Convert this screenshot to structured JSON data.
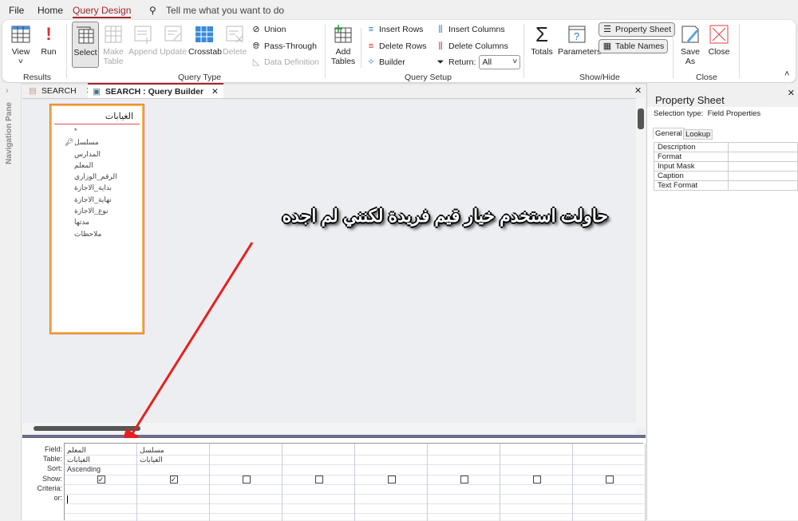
{
  "menu": {
    "items": [
      "File",
      "Home",
      "Query Design"
    ],
    "active": "Query Design",
    "tell_me": "Tell me what you want to do"
  },
  "ribbon": {
    "results": {
      "label": "Results",
      "view": "View",
      "run": "Run"
    },
    "query_type": {
      "label": "Query Type",
      "select": "Select",
      "make_table": "Make Table",
      "append": "Append",
      "update": "Update",
      "crosstab": "Crosstab",
      "delete": "Delete",
      "union": "Union",
      "pass_through": "Pass-Through",
      "data_definition": "Data Definition"
    },
    "query_setup": {
      "label": "Query Setup",
      "add_tables": "Add Tables",
      "insert_rows": "Insert Rows",
      "delete_rows": "Delete Rows",
      "builder": "Builder",
      "insert_columns": "Insert Columns",
      "delete_columns": "Delete Columns",
      "return_label": "Return:",
      "return_value": "All"
    },
    "show_hide": {
      "label": "Show/Hide",
      "totals": "Totals",
      "parameters": "Parameters",
      "property_sheet": "Property Sheet",
      "table_names": "Table Names"
    },
    "close": {
      "label": "Close",
      "save_as": "Save As",
      "close": "Close"
    }
  },
  "nav_pane": {
    "label": "Navigation Pane"
  },
  "tabs": [
    {
      "label": "SEARCH"
    },
    {
      "label": "SEARCH : Query Builder",
      "active": true
    }
  ],
  "table": {
    "name": "الغيابات",
    "fields": [
      "*",
      "مسلسل",
      "المدارس",
      "المعلم",
      "الرقم_الوزاري",
      "بداية_الاجازة",
      "نهاية_الاجازة",
      "نوع_الاجازة",
      "مدتها",
      "ملاحظات"
    ],
    "primary_key": "مسلسل"
  },
  "annotation": {
    "text": "حاولت استخدم خيار قيم فريدة لكنني لم اجده",
    "arrow_color": "#e52020"
  },
  "grid": {
    "row_labels": [
      "Field:",
      "Table:",
      "Sort:",
      "Show:",
      "Criteria:",
      "or:"
    ],
    "columns": [
      {
        "field": "المعلم",
        "table": "الغيابات",
        "sort": "Ascending",
        "show": true
      },
      {
        "field": "مسلسل",
        "table": "الغيابات",
        "sort": "",
        "show": true
      },
      {
        "show": false
      },
      {
        "show": false
      },
      {
        "show": false
      },
      {
        "show": false
      },
      {
        "show": false
      },
      {
        "show": false
      }
    ]
  },
  "property_sheet": {
    "title": "Property Sheet",
    "selection_type_label": "Selection type:",
    "selection_type": "Field Properties",
    "tabs": [
      "General",
      "Lookup"
    ],
    "properties": [
      "Description",
      "Format",
      "Input Mask",
      "Caption",
      "Text Format"
    ]
  },
  "colors": {
    "accent": "#a4262c",
    "field_list_border": "#f5b83c"
  }
}
